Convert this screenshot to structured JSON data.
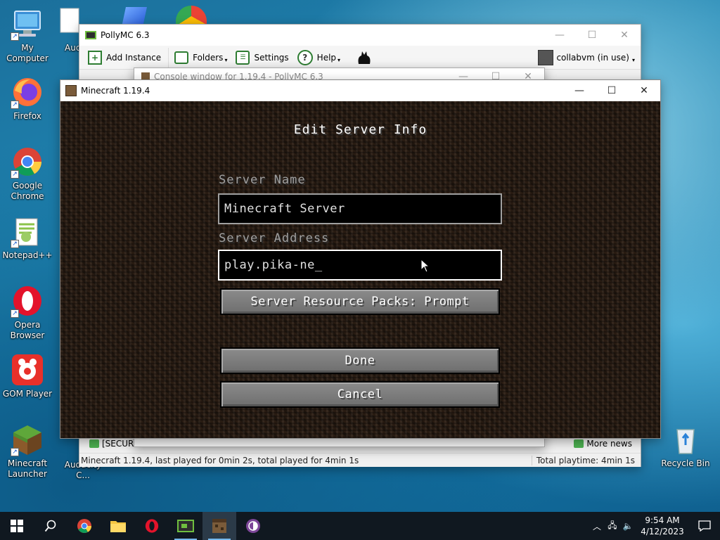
{
  "desktop": {
    "icons": [
      {
        "label": "My Computer"
      },
      {
        "label": "Aud"
      },
      {
        "label": "Firefox"
      },
      {
        "label": "Google Chrome"
      },
      {
        "label": "Notepad++"
      },
      {
        "label": "Opera Browser"
      },
      {
        "label": "GOM Player"
      },
      {
        "label": "Minecraft Launcher"
      },
      {
        "label": "Audacity C..."
      },
      {
        "label": "Recycle Bin"
      }
    ]
  },
  "pollymc": {
    "title": "PollyMC 6.3",
    "toolbar": {
      "add_instance": "Add Instance",
      "folders": "Folders",
      "settings": "Settings",
      "help": "Help",
      "account": "collabvm (in use)"
    },
    "statusbar": {
      "left": "Minecraft 1.19.4, last played for 0min 2s, total played for 4min 1s",
      "right": "Total playtime: 4min 1s"
    },
    "news_label": "More news",
    "security_label": "[SECURIT"
  },
  "console_window": {
    "title": "Console window for 1.19.4 - PollyMC 6.3"
  },
  "minecraft": {
    "title": "Minecraft 1.19.4",
    "screen_title": "Edit Server Info",
    "server_name_label": "Server Name",
    "server_name_value": "Minecraft Server",
    "server_address_label": "Server Address",
    "server_address_value": "play.pika-ne_",
    "resource_packs_button": "Server Resource Packs: Prompt",
    "done_button": "Done",
    "cancel_button": "Cancel"
  },
  "taskbar": {
    "time": "9:54 AM",
    "date": "4/12/2023"
  },
  "colors": {
    "mc_dirt": "#2a1d14",
    "mc_button": "#7a7a7a",
    "taskbar": "#101820",
    "accent": "#76b9ed"
  }
}
